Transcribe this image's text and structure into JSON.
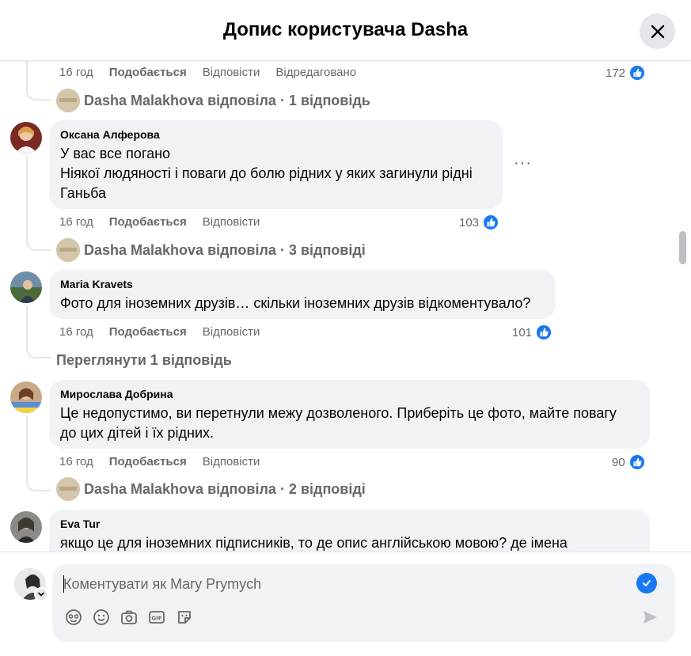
{
  "header": {
    "title": "Допис користувача Dasha"
  },
  "top_comment": {
    "time": "16 год",
    "like_label": "Подобається",
    "reply_label": "Відповісти",
    "edited_label": "Відредаговано",
    "reactions": "172",
    "replies_link": "Dasha Malakhova відповіла · 1 відповідь"
  },
  "comments": [
    {
      "author": "Оксана Алферова",
      "text": "У вас все погано\nНіякої людяності і поваги до болю рідних у яких загинули рідні\nГаньба",
      "time": "16 год",
      "like_label": "Подобається",
      "reply_label": "Відповісти",
      "reactions": "103",
      "more": "···",
      "replies_link": "Dasha Malakhova відповіла · 3 відповіді"
    },
    {
      "author": "Maria Kravets",
      "text": "Фото для іноземних друзів… скільки іноземних друзів відкоментувало?",
      "time": "16 год",
      "like_label": "Подобається",
      "reply_label": "Відповісти",
      "reactions": "101",
      "replies_link": "Переглянути 1 відповідь"
    },
    {
      "author": "Мирослава Добрина",
      "text": "Це недопустимо, ви перетнули межу дозволеного. Приберіть це фото, майте повагу\nдо цих дітей і їх рідних.",
      "time": "16 год",
      "like_label": "Подобається",
      "reply_label": "Відповісти",
      "reactions": "90",
      "replies_link": "Dasha Malakhova відповіла · 2 відповіді"
    },
    {
      "author": "Eva Tur",
      "text": "якщо це для іноземних підписників, то де опис англійською мовою? де імена"
    }
  ],
  "composer": {
    "placeholder": "Коментувати як Mary Prymych",
    "value": ""
  },
  "colors": {
    "accent": "#1877f2",
    "bubble": "#f0f2f5",
    "secondary_text": "#65676b"
  },
  "icons": [
    "close-icon",
    "like-icon",
    "more-icon",
    "check-icon",
    "avatar-sticker-icon",
    "emoji-icon",
    "camera-icon",
    "gif-icon",
    "sticker-icon",
    "send-icon",
    "chevron-down-icon"
  ]
}
